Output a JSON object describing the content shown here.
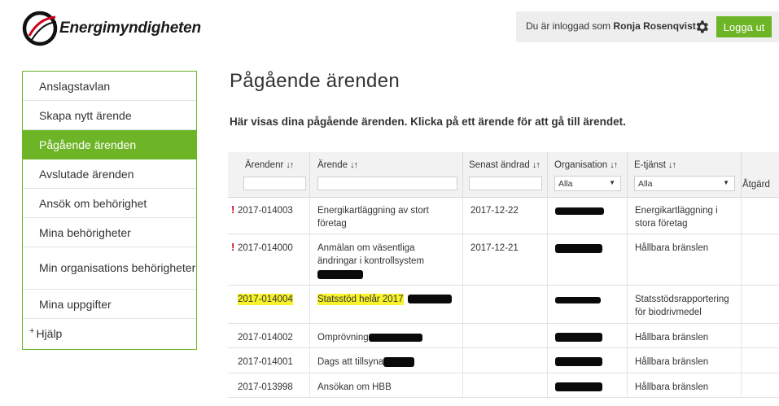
{
  "brand": {
    "name": "Energimyndigheten",
    "accent": "#6db526"
  },
  "user": {
    "prefix": "Du är inloggad som",
    "name": "Ronja Rosenqvist",
    "settings_icon": "gear-icon",
    "logout_label": "Logga ut"
  },
  "sidebar": {
    "items": [
      {
        "label": "Anslagstavlan"
      },
      {
        "label": "Skapa nytt ärende"
      },
      {
        "label": "Pågående ärenden",
        "active": true
      },
      {
        "label": "Avslutade ärenden"
      },
      {
        "label": "Ansök om behörighet"
      },
      {
        "label": "Mina behörigheter"
      },
      {
        "label": "Min organisations behörigheter"
      },
      {
        "label": "Mina uppgifter"
      },
      {
        "label": "Hjälp",
        "prefix": "+"
      }
    ]
  },
  "page": {
    "title": "Pågående ärenden",
    "intro": "Här visas dina pågående ärenden. Klicka på ett ärende för att gå till ärendet."
  },
  "table": {
    "columns": [
      {
        "label": "Ärendenr",
        "sort": "↓↑"
      },
      {
        "label": "Ärende",
        "sort": "↓↑"
      },
      {
        "label": "Senast ändrad",
        "sort": "↓↑"
      },
      {
        "label": "Organisation",
        "sort": "↓↑",
        "filter": "Alla"
      },
      {
        "label": "E-tjänst",
        "sort": "↓↑",
        "filter": "Alla"
      },
      {
        "label": "Åtgärd"
      }
    ],
    "rows": [
      {
        "flag": "!",
        "nr": "2017-014003",
        "arende": "Energikartläggning av stort företag",
        "changed": "2017-12-22",
        "etjanst": "Energikartläggning i stora företag"
      },
      {
        "flag": "!",
        "nr": "2017-014000",
        "arende": "Anmälan om väsentliga ändringar i kontrollsystem",
        "changed": "2017-12-21",
        "etjanst": "Hållbara bränslen"
      },
      {
        "flag": "",
        "nr": "2017-014004",
        "arende": "Statsstöd helår 2017",
        "changed": "",
        "etjanst": "Statsstödsrapportering för biodrivmedel",
        "highlight": true
      },
      {
        "flag": "",
        "nr": "2017-014002",
        "arende": "Omprövning",
        "changed": "",
        "etjanst": "Hållbara bränslen"
      },
      {
        "flag": "",
        "nr": "2017-014001",
        "arende": "Dags att tillsyna",
        "changed": "",
        "etjanst": "Hållbara bränslen"
      },
      {
        "flag": "",
        "nr": "2017-013998",
        "arende": "Ansökan om HBB",
        "changed": "",
        "etjanst": "Hållbara bränslen"
      }
    ]
  }
}
